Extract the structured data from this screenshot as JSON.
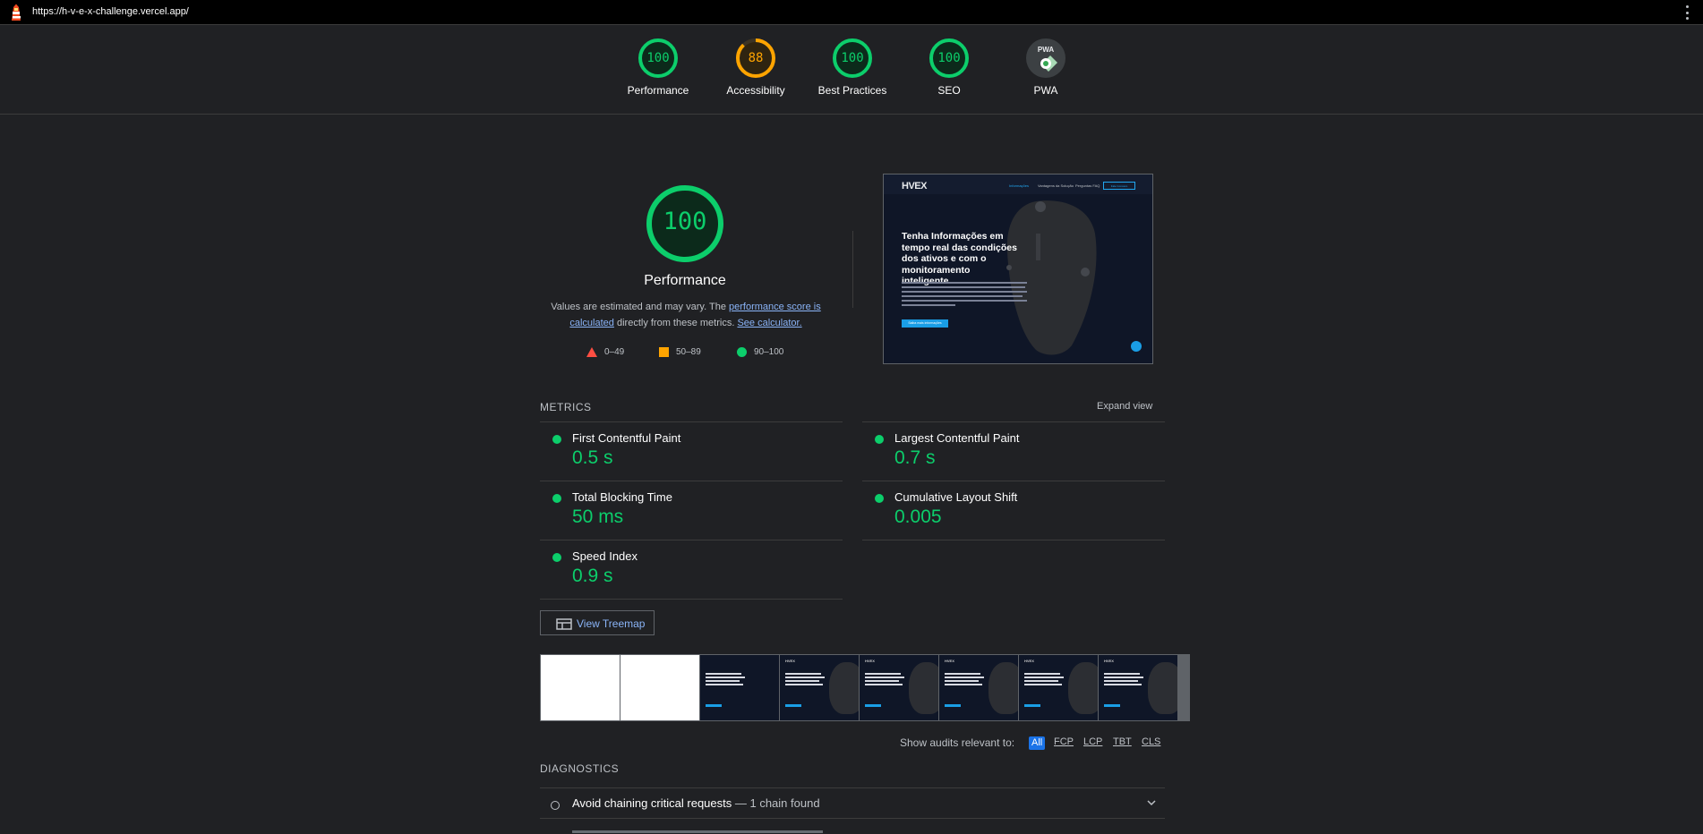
{
  "topbar": {
    "url": "https://h-v-e-x-challenge.vercel.app/"
  },
  "categories": [
    {
      "label": "Performance",
      "score": "100",
      "color": "#0cce6b"
    },
    {
      "label": "Accessibility",
      "score": "88",
      "color": "#ffa400"
    },
    {
      "label": "Best Practices",
      "score": "100",
      "color": "#0cce6b"
    },
    {
      "label": "SEO",
      "score": "100",
      "color": "#0cce6b"
    },
    {
      "label": "PWA",
      "score": "",
      "color": "#9aa0a6"
    }
  ],
  "pwa_badge": "PWA",
  "main": {
    "score": "100",
    "label": "Performance",
    "desc_1": "Values are estimated and may vary. The ",
    "desc_link_1": "performance score is calculated",
    "desc_2": " directly from these metrics. ",
    "desc_link_2": "See calculator."
  },
  "legend": {
    "fail": "0–49",
    "average": "50–89",
    "pass": "90–100"
  },
  "screenshot": {
    "logo": "HVEX",
    "nav": [
      "Informações",
      "Vantagens da Solução",
      "Perguntas FAQ"
    ],
    "nav_button": "Fale Conosco",
    "headline": "Tenha Informações em tempo real das condições dos ativos e com o monitoramento inteligente",
    "cta": "Saiba mais informações"
  },
  "metrics_section": {
    "title": "METRICS",
    "expand": "Expand view"
  },
  "metrics": [
    {
      "title": "First Contentful Paint",
      "value": "0.5 s"
    },
    {
      "title": "Largest Contentful Paint",
      "value": "0.7 s"
    },
    {
      "title": "Total Blocking Time",
      "value": "50 ms"
    },
    {
      "title": "Cumulative Layout Shift",
      "value": "0.005"
    },
    {
      "title": "Speed Index",
      "value": "0.9 s"
    }
  ],
  "treemap": {
    "label": "View Treemap"
  },
  "filmstrip": {
    "frame_logo": "HVEX"
  },
  "filters": {
    "label": "Show audits relevant to:",
    "chips": [
      "All",
      "FCP",
      "LCP",
      "TBT",
      "CLS"
    ]
  },
  "diagnostics": {
    "title": "DIAGNOSTICS",
    "items": [
      {
        "title": "Avoid chaining critical requests",
        "detail": "— 1 chain found"
      }
    ]
  },
  "colors": {
    "pass": "#0cce6b",
    "average": "#ffa400",
    "fail": "#ff4e42",
    "link": "#8ab4f8"
  }
}
